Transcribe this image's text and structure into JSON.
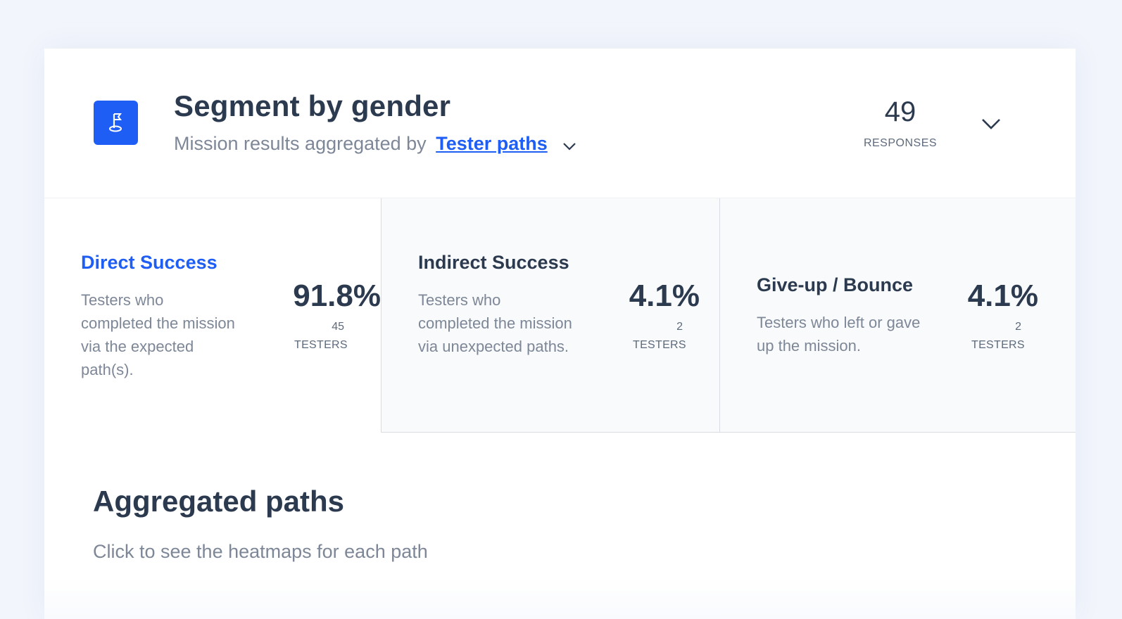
{
  "header": {
    "title": "Segment by gender",
    "subtitle_prefix": "Mission results aggregated by",
    "subtitle_link": "Tester paths",
    "responses_count": "49",
    "responses_label": "RESPONSES",
    "icon": "flag-icon"
  },
  "stats": [
    {
      "title": "Direct Success",
      "description": "Testers who completed the mission via the expected path(s).",
      "percent": "91.8%",
      "count": "45",
      "count_label": "TESTERS"
    },
    {
      "title": "Indirect Success",
      "description": "Testers who completed the mission via unexpected paths.",
      "percent": "4.1%",
      "count": "2",
      "count_label": "TESTERS"
    },
    {
      "title": "Give-up / Bounce",
      "description": "Testers who left or gave up the mission.",
      "percent": "4.1%",
      "count": "2",
      "count_label": "TESTERS"
    }
  ],
  "aggregated": {
    "title": "Aggregated paths",
    "subtitle": "Click to see the heatmaps for each path"
  },
  "colors": {
    "accent": "#1f5ef5",
    "text": "#2c3a4f",
    "muted": "#7d8797",
    "background": "#f2f5fc"
  }
}
